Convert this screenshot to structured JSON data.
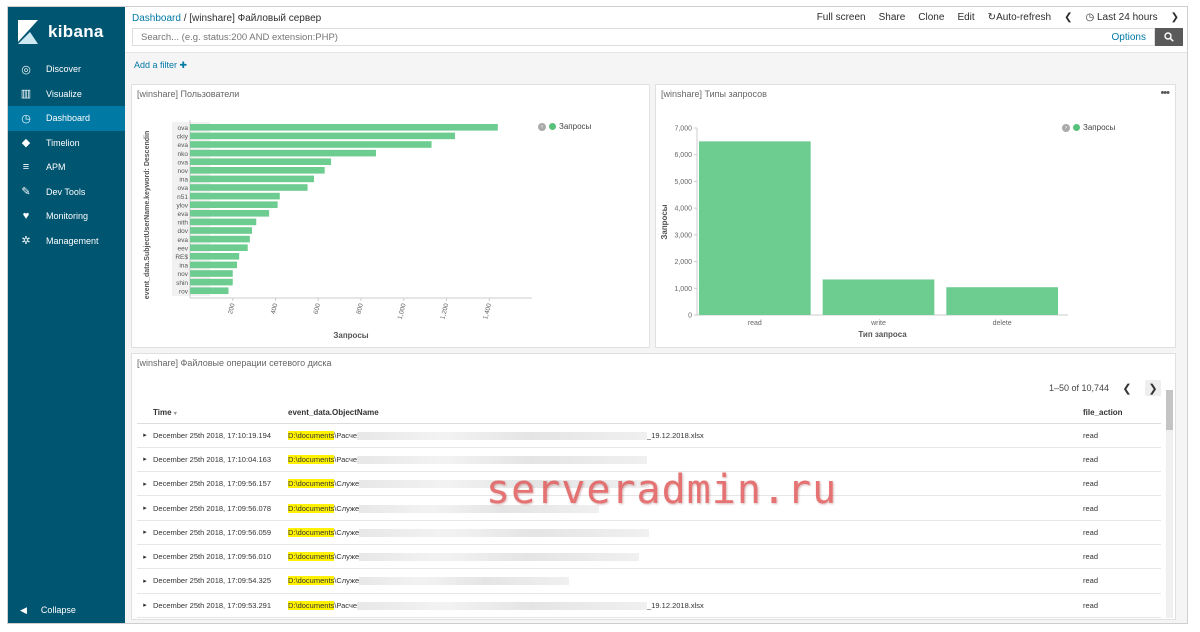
{
  "sidebar": {
    "brand": "kibana",
    "items": [
      {
        "label": "Discover",
        "icon": "compass-icon",
        "glyph": "◎"
      },
      {
        "label": "Visualize",
        "icon": "bar-chart-icon",
        "glyph": "▥"
      },
      {
        "label": "Dashboard",
        "icon": "dashboard-icon",
        "glyph": "◷"
      },
      {
        "label": "Timelion",
        "icon": "timelion-icon",
        "glyph": "◆"
      },
      {
        "label": "APM",
        "icon": "apm-icon",
        "glyph": "≡"
      },
      {
        "label": "Dev Tools",
        "icon": "wrench-icon",
        "glyph": "✎"
      },
      {
        "label": "Monitoring",
        "icon": "heartbeat-icon",
        "glyph": "♥"
      },
      {
        "label": "Management",
        "icon": "gear-icon",
        "glyph": "✲"
      }
    ],
    "active_item": "Dashboard",
    "collapse_label": "Collapse"
  },
  "breadcrumb": {
    "root": "Dashboard",
    "sep": "/",
    "current": "[winshare] Файловый сервер"
  },
  "toolbar": {
    "full_screen": "Full screen",
    "share": "Share",
    "clone": "Clone",
    "edit": "Edit",
    "auto_refresh": "Auto-refresh",
    "time_range": "Last 24 hours"
  },
  "search": {
    "placeholder": "Search... (e.g. status:200 AND extension:PHP)",
    "options": "Options"
  },
  "filter": {
    "add_label": "Add a filter"
  },
  "colors": {
    "sidebar": "#005571",
    "active": "#0079a5",
    "bar": "#6dcc8f",
    "highlight": "#fff200"
  },
  "panels": {
    "users": {
      "title": "[winshare] Пользователи",
      "legend": "Запросы"
    },
    "types": {
      "title": "[winshare] Типы запросов",
      "legend": "Запросы"
    },
    "files": {
      "title": "[winshare] Файловые операции сетевого диска"
    }
  },
  "chart_data": [
    {
      "type": "bar",
      "orientation": "horizontal",
      "categories": [
        "ova",
        "ckiy",
        "eva",
        "nko",
        "ova",
        "nov",
        "ina",
        "ova",
        "n51",
        "ylov",
        "eva",
        "nith",
        "dov",
        "eva",
        "eev",
        "RE$",
        "ina",
        "nov",
        "shin",
        "rov"
      ],
      "values": [
        1440,
        1240,
        1130,
        870,
        660,
        630,
        580,
        550,
        420,
        410,
        370,
        310,
        290,
        280,
        270,
        230,
        220,
        200,
        200,
        180
      ],
      "xlabel": "Запросы",
      "ylabel": "event_data.SubjectUserName.keyword: Descendin",
      "xticks": [
        200,
        400,
        600,
        800,
        1000,
        1200,
        1400
      ],
      "xtick_labels": [
        "200",
        "400",
        "600",
        "800",
        "1,000",
        "1,200",
        "1,400"
      ],
      "xlim": [
        0,
        1600
      ],
      "legend": [
        "Запросы"
      ],
      "legend_position": "top-right"
    },
    {
      "type": "bar",
      "categories": [
        "read",
        "write",
        "delete"
      ],
      "values": [
        6500,
        1330,
        1040
      ],
      "xlabel": "Тип запроса",
      "ylabel": "Запросы",
      "ylim": [
        0,
        7000
      ],
      "yticks": [
        0,
        1000,
        2000,
        3000,
        4000,
        5000,
        6000,
        7000
      ],
      "ytick_labels": [
        "0",
        "1,000",
        "2,000",
        "3,000",
        "4,000",
        "5,000",
        "6,000",
        "7,000"
      ],
      "legend": [
        "Запросы"
      ],
      "legend_position": "top-right"
    }
  ],
  "table": {
    "pager_text": "1–50 of 10,744",
    "headers": {
      "time": "Time",
      "object": "event_data.ObjectName",
      "action": "file_action"
    },
    "rows": [
      {
        "time": "December 25th 2018, 17:10:19.194",
        "drive": "D:\\",
        "folder": "documents",
        "sep": "\\",
        "name": "Расче",
        "tail": "_19.12.2018.xlsx",
        "action": "read"
      },
      {
        "time": "December 25th 2018, 17:10:04.163",
        "drive": "D:\\",
        "folder": "documents",
        "sep": "\\",
        "name": "Расче",
        "tail": "",
        "action": "read"
      },
      {
        "time": "December 25th 2018, 17:09:56.157",
        "drive": "D:\\",
        "folder": "documents",
        "sep": "\\",
        "name": "Служе",
        "tail": "",
        "action": "read"
      },
      {
        "time": "December 25th 2018, 17:09:56.078",
        "drive": "D:\\",
        "folder": "documents",
        "sep": "\\",
        "name": "Служе",
        "tail": "",
        "action": "read"
      },
      {
        "time": "December 25th 2018, 17:09:56.059",
        "drive": "D:\\",
        "folder": "documents",
        "sep": "\\",
        "name": "Служе",
        "tail": "",
        "action": "read"
      },
      {
        "time": "December 25th 2018, 17:09:56.010",
        "drive": "D:\\",
        "folder": "documents",
        "sep": "\\",
        "name": "Служе",
        "tail": "",
        "action": "read"
      },
      {
        "time": "December 25th 2018, 17:09:54.325",
        "drive": "D:\\",
        "folder": "documents",
        "sep": "\\",
        "name": "Служе",
        "tail": "",
        "action": "read"
      },
      {
        "time": "December 25th 2018, 17:09:53.291",
        "drive": "D:\\",
        "folder": "documents",
        "sep": "\\",
        "name": "Расче",
        "tail": "_19.12.2018.xlsx",
        "action": "read"
      }
    ]
  },
  "watermark": "serveradmin.ru"
}
